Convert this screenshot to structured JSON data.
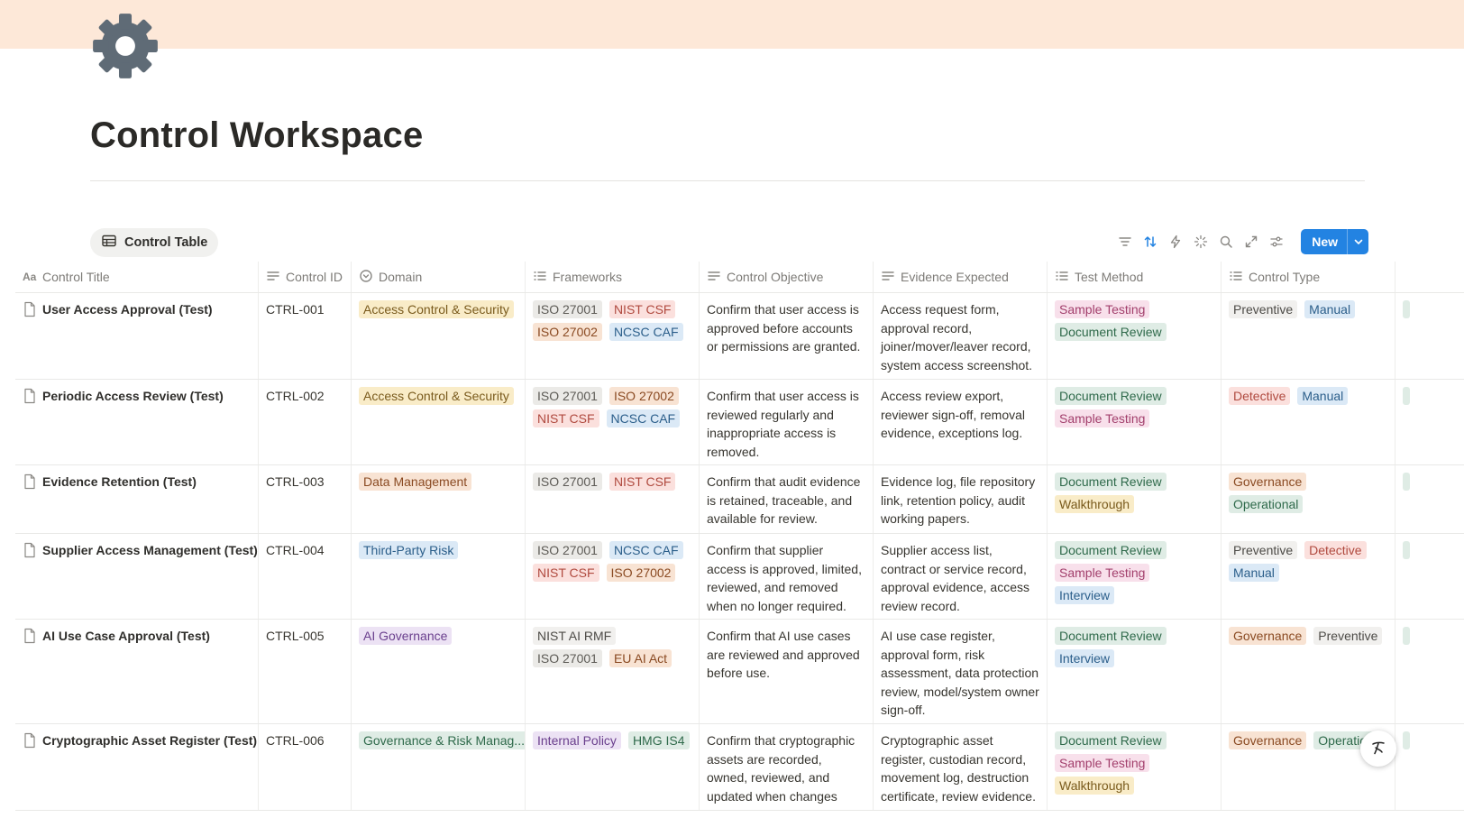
{
  "page": {
    "title": "Control Workspace",
    "icon": "gear-icon",
    "cover_color": "#fde8d8"
  },
  "view": {
    "tab_label": "Control Table",
    "tab_icon": "table-icon"
  },
  "toolbar": {
    "icons": [
      "filter-icon",
      "sort-icon",
      "automation-icon",
      "ai-sparkle-icon",
      "search-icon",
      "expand-icon",
      "settings-icon"
    ],
    "new_label": "New",
    "accent_color": "#2383e2"
  },
  "table": {
    "columns": [
      {
        "label": "Control Title",
        "icon": "title-aa-icon"
      },
      {
        "label": "Control ID",
        "icon": "text-lines-icon"
      },
      {
        "label": "Domain",
        "icon": "select-icon"
      },
      {
        "label": "Frameworks",
        "icon": "multi-select-icon"
      },
      {
        "label": "Control Objective",
        "icon": "text-lines-icon"
      },
      {
        "label": "Evidence Expected",
        "icon": "text-lines-icon"
      },
      {
        "label": "Test Method",
        "icon": "multi-select-icon"
      },
      {
        "label": "Control Type",
        "icon": "multi-select-icon"
      }
    ],
    "rows": [
      {
        "title": "User Access Approval (Test)",
        "id": "CTRL-001",
        "domain": {
          "label": "Access Control & Security",
          "color": "yellow"
        },
        "frameworks": [
          {
            "label": "ISO 27001",
            "color": "gray"
          },
          {
            "label": "NIST CSF",
            "color": "red"
          },
          {
            "label": "ISO 27002",
            "color": "orange"
          },
          {
            "label": "NCSC CAF",
            "color": "blue"
          }
        ],
        "objective": "Confirm that user access is approved before accounts or permissions are granted.",
        "evidence": "Access request form, approval record, joiner/mover/leaver record, system access screenshot.",
        "test_method": [
          {
            "label": "Sample Testing",
            "color": "pink"
          },
          {
            "label": "Document Review",
            "color": "green"
          }
        ],
        "control_type": [
          {
            "label": "Preventive",
            "color": "light"
          },
          {
            "label": "Manual",
            "color": "blue"
          }
        ]
      },
      {
        "title": "Periodic Access Review (Test)",
        "id": "CTRL-002",
        "domain": {
          "label": "Access Control & Security",
          "color": "yellow"
        },
        "frameworks": [
          {
            "label": "ISO 27001",
            "color": "gray"
          },
          {
            "label": "ISO 27002",
            "color": "orange"
          },
          {
            "label": "NIST CSF",
            "color": "red"
          },
          {
            "label": "NCSC CAF",
            "color": "blue"
          }
        ],
        "objective": "Confirm that user access is reviewed regularly and inappropriate access is removed.",
        "evidence": "Access review export, reviewer sign-off, removal evidence, exceptions log.",
        "test_method": [
          {
            "label": "Document Review",
            "color": "green"
          },
          {
            "label": "Sample Testing",
            "color": "pink"
          }
        ],
        "control_type": [
          {
            "label": "Detective",
            "color": "red"
          },
          {
            "label": "Manual",
            "color": "blue"
          }
        ]
      },
      {
        "title": "Evidence Retention (Test)",
        "id": "CTRL-003",
        "domain": {
          "label": "Data Management",
          "color": "orange"
        },
        "frameworks": [
          {
            "label": "ISO 27001",
            "color": "gray"
          },
          {
            "label": "NIST CSF",
            "color": "red"
          }
        ],
        "objective": "Confirm that audit evidence is retained, traceable, and available for review.",
        "evidence": "Evidence log, file repository link, retention policy, audit working papers.",
        "test_method": [
          {
            "label": "Document Review",
            "color": "green"
          },
          {
            "label": "Walkthrough",
            "color": "yellow"
          }
        ],
        "control_type": [
          {
            "label": "Governance",
            "color": "orange"
          },
          {
            "label": "Operational",
            "color": "green"
          }
        ]
      },
      {
        "title": "Supplier Access Management (Test)",
        "id": "CTRL-004",
        "domain": {
          "label": "Third-Party Risk",
          "color": "blue"
        },
        "frameworks": [
          {
            "label": "ISO 27001",
            "color": "gray"
          },
          {
            "label": "NCSC CAF",
            "color": "blue"
          },
          {
            "label": "NIST CSF",
            "color": "red"
          },
          {
            "label": "ISO 27002",
            "color": "orange"
          }
        ],
        "objective": "Confirm that supplier access is approved, limited, reviewed, and removed when no longer required.",
        "evidence": "Supplier access list, contract or service record, approval evidence, access review record.",
        "test_method": [
          {
            "label": "Document Review",
            "color": "green"
          },
          {
            "label": "Sample Testing",
            "color": "pink"
          },
          {
            "label": "Interview",
            "color": "blue"
          }
        ],
        "control_type": [
          {
            "label": "Preventive",
            "color": "light"
          },
          {
            "label": "Detective",
            "color": "red"
          },
          {
            "label": "Manual",
            "color": "blue"
          }
        ]
      },
      {
        "title": "AI Use Case Approval (Test)",
        "id": "CTRL-005",
        "domain": {
          "label": "AI Governance",
          "color": "purple"
        },
        "frameworks": [
          {
            "label": "NIST AI RMF",
            "color": "light"
          },
          {
            "label": "ISO 27001",
            "color": "gray"
          },
          {
            "label": "EU AI Act",
            "color": "orange"
          }
        ],
        "objective": "Confirm that AI use cases are reviewed and approved before use.",
        "evidence": "AI use case register, approval form, risk assessment, data protection review, model/system owner sign-off.",
        "test_method": [
          {
            "label": "Document Review",
            "color": "green"
          },
          {
            "label": "Interview",
            "color": "blue"
          }
        ],
        "control_type": [
          {
            "label": "Governance",
            "color": "orange"
          },
          {
            "label": "Preventive",
            "color": "light"
          }
        ]
      },
      {
        "title": "Cryptographic Asset Register (Test)",
        "id": "CTRL-006",
        "domain": {
          "label": "Governance & Risk Manag...",
          "color": "green"
        },
        "frameworks": [
          {
            "label": "Internal Policy",
            "color": "purple"
          },
          {
            "label": "HMG IS4",
            "color": "green"
          }
        ],
        "objective": "Confirm that cryptographic assets are recorded, owned, reviewed, and updated when changes occur.",
        "evidence": "Cryptographic asset register, custodian record, movement log, destruction certificate, review evidence.",
        "test_method": [
          {
            "label": "Document Review",
            "color": "green"
          },
          {
            "label": "Sample Testing",
            "color": "pink"
          },
          {
            "label": "Walkthrough",
            "color": "yellow"
          }
        ],
        "control_type": [
          {
            "label": "Governance",
            "color": "orange"
          },
          {
            "label": "Operation",
            "color": "green"
          }
        ]
      }
    ]
  }
}
